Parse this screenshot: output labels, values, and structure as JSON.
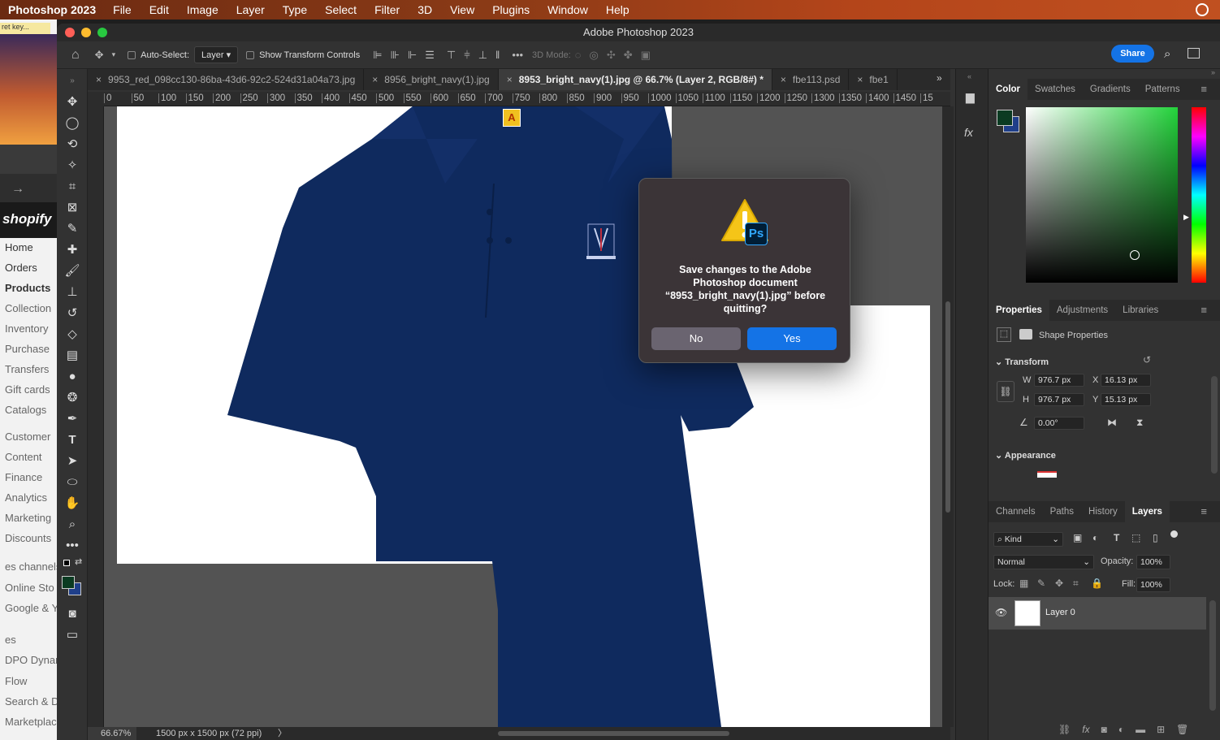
{
  "menubar": {
    "app": "Photoshop 2023",
    "items": [
      "File",
      "Edit",
      "Image",
      "Layer",
      "Type",
      "Select",
      "Filter",
      "3D",
      "View",
      "Plugins",
      "Window",
      "Help"
    ]
  },
  "browser": {
    "tab_label": "ret key...",
    "logo": "shopify",
    "nav": [
      "Home",
      "Orders",
      "Products",
      "Collection",
      "Inventory",
      "Purchase",
      "Transfers",
      "Gift cards",
      "Catalogs",
      "Customer",
      "Content",
      "Finance",
      "Analytics",
      "Marketing",
      "Discounts",
      "es channels",
      "Online Sto",
      "Google & Y",
      "es",
      "DPO Dynan",
      "Flow",
      "Search & D",
      "Marketplac"
    ]
  },
  "window": {
    "title": "Adobe Photoshop 2023"
  },
  "options": {
    "auto_select_label": "Auto-Select:",
    "auto_select_value": "Layer",
    "transform_label": "Show Transform Controls",
    "mode3d": "3D Mode:",
    "share": "Share"
  },
  "tabs": [
    {
      "label": "9953_red_098cc130-86ba-43d6-92c2-524d31a04a73.jpg",
      "active": false
    },
    {
      "label": "8956_bright_navy(1).jpg",
      "active": false
    },
    {
      "label": "8953_bright_navy(1).jpg @ 66.7% (Layer 2, RGB/8#) *",
      "active": true
    },
    {
      "label": "fbe113.psd",
      "active": false
    },
    {
      "label": "fbe1",
      "active": false
    }
  ],
  "ruler_ticks": [
    "0",
    "50",
    "100",
    "150",
    "200",
    "250",
    "300",
    "350",
    "400",
    "450",
    "500",
    "550",
    "600",
    "650",
    "700",
    "750",
    "800",
    "850",
    "900",
    "950",
    "1000",
    "1050",
    "1100",
    "1150",
    "1200",
    "1250",
    "1300",
    "1350",
    "1400",
    "1450",
    "15"
  ],
  "status": {
    "zoom": "66.67%",
    "doc": "1500 px x 1500 px (72 ppi)",
    "arrow": "〉"
  },
  "dialog": {
    "message": "Save changes to the Adobe Photoshop document “8953_bright_navy(1).jpg” before quitting?",
    "no": "No",
    "yes": "Yes",
    "badge": "Ps"
  },
  "color_panel": {
    "tabs": [
      "Color",
      "Swatches",
      "Gradients",
      "Patterns"
    ],
    "fg": "#0b3b22",
    "bg": "#1f3f8a"
  },
  "properties": {
    "tabs": [
      "Properties",
      "Adjustments",
      "Libraries"
    ],
    "title": "Shape Properties",
    "transform_label": "Transform",
    "w_label": "W",
    "w": "976.7 px",
    "x_label": "X",
    "x": "16.13 px",
    "h_label": "H",
    "h": "976.7 px",
    "y_label": "Y",
    "y": "15.13 px",
    "angle": "0.00°",
    "appearance_label": "Appearance"
  },
  "layers": {
    "tabs": [
      "Channels",
      "Paths",
      "History",
      "Layers"
    ],
    "filter": "Kind",
    "blend": "Normal",
    "opacity_label": "Opacity:",
    "opacity": "100%",
    "lock_label": "Lock:",
    "fill_label": "Fill:",
    "fill": "100%",
    "items": [
      {
        "name": "Layer 0"
      }
    ]
  },
  "colors": {
    "accent": "#1473e6",
    "shirt": "#0f2a5e"
  }
}
